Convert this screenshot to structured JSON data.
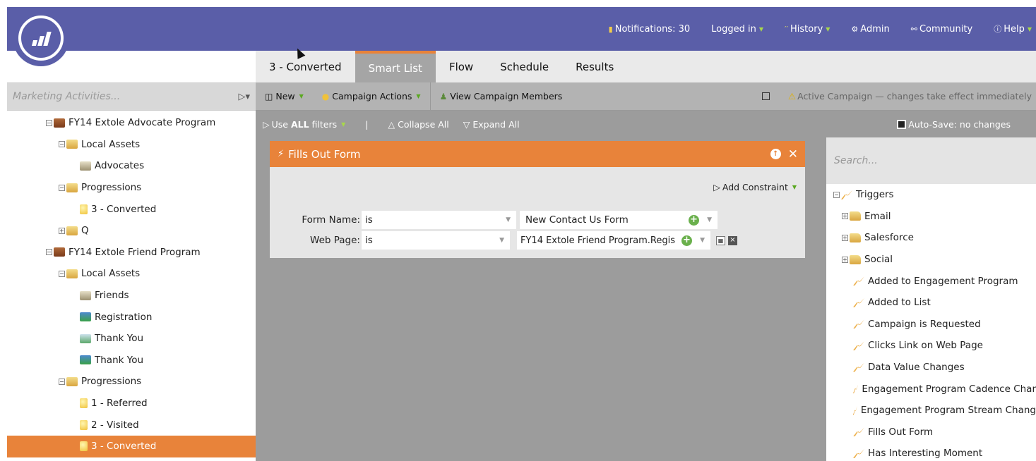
{
  "topnav": {
    "notifications": "Notifications: 30",
    "logged_in": "Logged in",
    "history": "History",
    "admin": "Admin",
    "community": "Community",
    "help": "Help"
  },
  "left": {
    "search_placeholder": "Marketing Activities...",
    "tree": [
      {
        "label": "FY14 Extole Advocate Program",
        "icon": "program-icon",
        "toggle": "−"
      },
      {
        "label": "Local Assets",
        "icon": "folder-icon",
        "toggle": "−"
      },
      {
        "label": "Advocates",
        "icon": "list-icon",
        "toggle": ""
      },
      {
        "label": "Progressions",
        "icon": "folder-icon",
        "toggle": "−"
      },
      {
        "label": "3 - Converted",
        "icon": "campaign-bulb-icon",
        "toggle": ""
      },
      {
        "label": "Q",
        "icon": "folder-icon",
        "toggle": "+"
      },
      {
        "label": "FY14 Extole Friend Program",
        "icon": "program-icon",
        "toggle": "−"
      },
      {
        "label": "Local Assets",
        "icon": "folder-icon",
        "toggle": "−"
      },
      {
        "label": "Friends",
        "icon": "list-icon",
        "toggle": ""
      },
      {
        "label": "Registration",
        "icon": "form-icon",
        "toggle": ""
      },
      {
        "label": "Thank You",
        "icon": "landing-page-icon",
        "toggle": ""
      },
      {
        "label": "Thank You",
        "icon": "form-icon",
        "toggle": ""
      },
      {
        "label": "Progressions",
        "icon": "folder-icon",
        "toggle": "−"
      },
      {
        "label": "1 - Referred",
        "icon": "campaign-bulb-icon",
        "toggle": ""
      },
      {
        "label": "2 - Visited",
        "icon": "campaign-bulb-icon",
        "toggle": ""
      },
      {
        "label": "3 - Converted",
        "icon": "campaign-bulb-icon",
        "toggle": ""
      }
    ]
  },
  "tabs": [
    "3 - Converted",
    "Smart List",
    "Flow",
    "Schedule",
    "Results"
  ],
  "toolbar": {
    "new": "New",
    "campaign_actions": "Campaign Actions",
    "view_members": "View Campaign Members",
    "active_notice": "Active Campaign — changes take effect immediately"
  },
  "toolbar2": {
    "use_prefix": "Use ",
    "use_all": "ALL",
    "use_suffix": " filters",
    "separator": "|",
    "collapse": "Collapse All",
    "expand": "Expand All",
    "autosave": "Auto-Save: no changes"
  },
  "filter": {
    "title": "Fills Out Form",
    "add_constraint": "Add Constraint",
    "rows": [
      {
        "label": "Form Name:",
        "operator": "is",
        "value": "New Contact Us Form"
      },
      {
        "label": "Web Page:",
        "operator": "is",
        "value": "FY14 Extole Friend Program.Regis"
      }
    ]
  },
  "right": {
    "search_placeholder": "Search...",
    "tree": [
      {
        "label": "Triggers",
        "toggle": "−",
        "icon": "trigger-icon",
        "indent": 1
      },
      {
        "label": "Email",
        "toggle": "+",
        "icon": "folder-icon",
        "indent": 2
      },
      {
        "label": "Salesforce",
        "toggle": "+",
        "icon": "folder-icon",
        "indent": 2
      },
      {
        "label": "Social",
        "toggle": "+",
        "icon": "folder-icon",
        "indent": 2
      },
      {
        "label": "Added to Engagement Program",
        "toggle": "",
        "icon": "trigger-icon",
        "indent": 3
      },
      {
        "label": "Added to List",
        "toggle": "",
        "icon": "trigger-icon",
        "indent": 3
      },
      {
        "label": "Campaign is Requested",
        "toggle": "",
        "icon": "trigger-icon",
        "indent": 3
      },
      {
        "label": "Clicks Link on Web Page",
        "toggle": "",
        "icon": "trigger-icon",
        "indent": 3
      },
      {
        "label": "Data Value Changes",
        "toggle": "",
        "icon": "trigger-icon",
        "indent": 3
      },
      {
        "label": "Engagement Program Cadence Char",
        "toggle": "",
        "icon": "trigger-icon",
        "indent": 3
      },
      {
        "label": "Engagement Program Stream Chang",
        "toggle": "",
        "icon": "trigger-icon",
        "indent": 3
      },
      {
        "label": "Fills Out Form",
        "toggle": "",
        "icon": "trigger-icon",
        "indent": 3
      },
      {
        "label": "Has Interesting Moment",
        "toggle": "",
        "icon": "trigger-icon",
        "indent": 3
      }
    ]
  },
  "colors": {
    "brand": "#5a5ea8",
    "accent": "#e8833a",
    "positive": "#6ab04c"
  }
}
